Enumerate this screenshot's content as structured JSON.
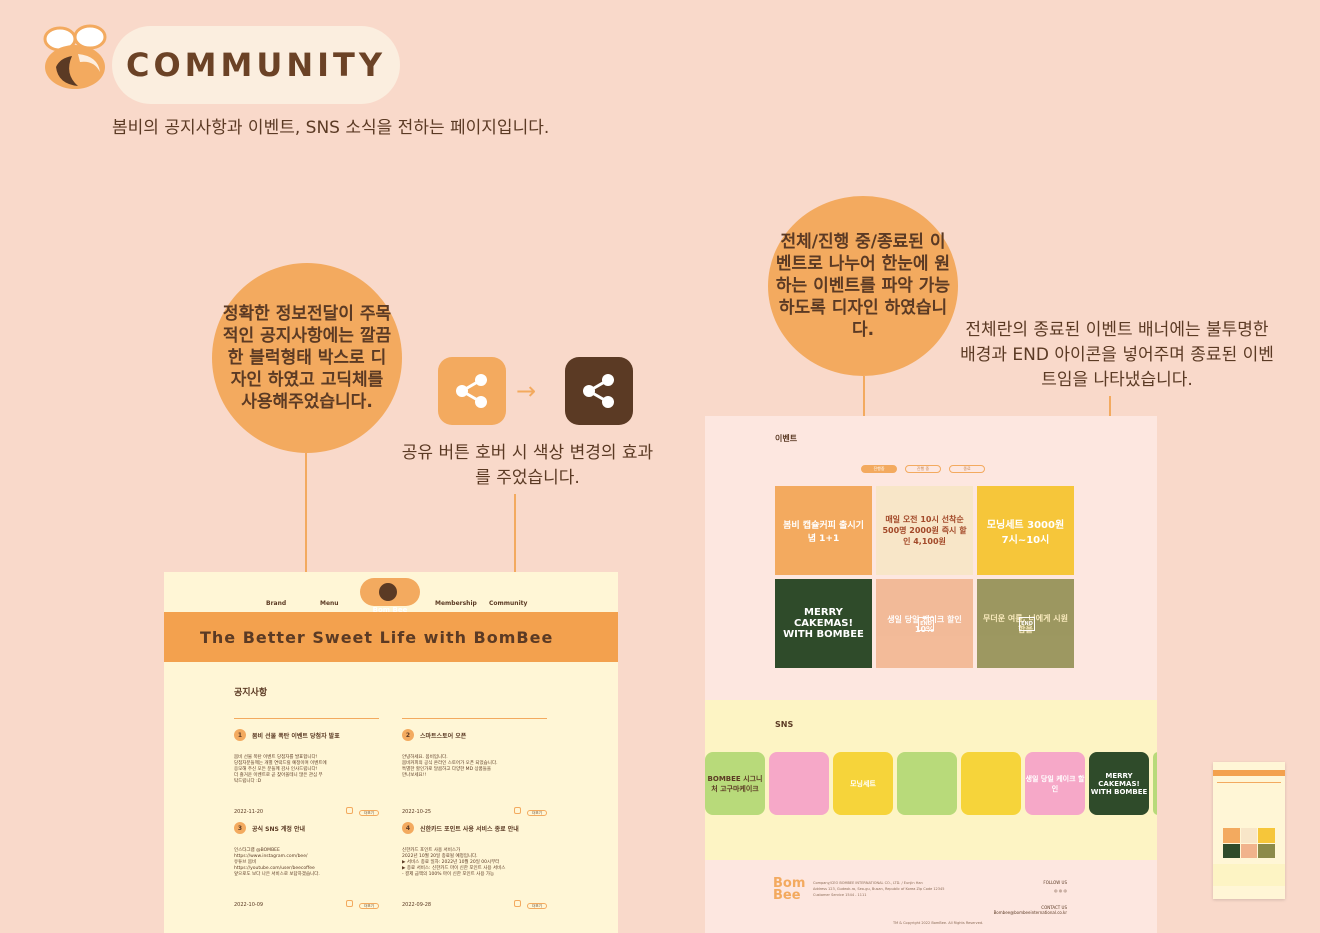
{
  "header": {
    "title": "COMMUNITY",
    "subtitle": "봄비의 공지사항과 이벤트, SNS 소식을 전하는 페이지입니다."
  },
  "callouts": {
    "notice": "정확한 정보전달이 주목적인 공지사항에는 깔끔한 블럭형태 박스로 디자인 하였고 고딕체를 사용해주었습니다.",
    "filter": "전체/진행 중/종료된 이벤트로 나누어 한눈에 원하는 이벤트를 파악 가능하도록 디자인 하였습니다.",
    "share": "공유 버튼 호버 시 색상 변경의 효과를 주었습니다.",
    "ended": "전체란의 종료된 이벤트 배너에는 불투명한 배경과 END 아이콘을 넣어주며 종료된 이벤트임을 나타냈습니다."
  },
  "left_mock": {
    "nav": [
      "Brand",
      "Menu",
      "Membership",
      "Community"
    ],
    "badge": "Bom Bee",
    "banner": "The Better Sweet Life with BomBee",
    "banner_next": "T",
    "section": "공지사항",
    "notices": [
      {
        "num": "1",
        "title": "봄비 선물 폭탄 이벤트 당첨자 발표",
        "body": "봄비 선물 폭탄 이벤트 당첨자를 발표합니다!\n당첨자분들께는 개별 연락드릴 예정이며 이벤트에\n응모해 주신 모든 분들께 감사 인사드립니다!\n더 즐거운 이벤트로 곧 찾아올테니 많은 관심 부\n탁드립니다 :D",
        "date": "2022-11-20",
        "btn": "더보기"
      },
      {
        "num": "2",
        "title": "스마트스토어 오픈",
        "body": "안녕하세요. 봄비입니다.\n봄비커피의 공식 온라인 스토어가 오픈 되었습니다.\n특별한 할인가로 달콤하고 다양한 MD 상품들을\n만나보세요!!",
        "date": "2022-10-25",
        "btn": "더보기"
      },
      {
        "num": "3",
        "title": "공식 SNS 계정 안내",
        "body": "인스타그램 @BOMBEE\nhttps://www.instagram.com/bee/\n유튜브 봄비\nhttps://youtube.com/user/beecoffee\n앞으로도 보다 나은 서비스로 보답하겠습니다.",
        "date": "2022-10-09",
        "btn": "더보기"
      },
      {
        "num": "4",
        "title": "신한카드 포인트 사용 서비스 종료 안내",
        "body": "신한카드 포인트 사용 서비스가\n2022년 10월 20일 종료될 예정입니다.\n▶ 서비스 종료 일자: 2022년 10월 20일 00시부터\n▶ 종료 서비스: 신한카드 마이 신한 포인트 사용 서비스\n- 결제 금액의 100% 마이 신한 포인트 사용 가능",
        "date": "2022-09-28",
        "btn": "더보기"
      }
    ]
  },
  "right_mock": {
    "title": "이벤트",
    "filters": [
      "진행중",
      "진행 중",
      "종료"
    ],
    "tiles": [
      {
        "text": "봄비 캡슐커피 출시기념 1+1",
        "bg": "#f3aa5f",
        "fg": "#ffffff"
      },
      {
        "text": "매일 오전 10시 선착순 500명 2000원 즉시 할인 4,100원",
        "bg": "#f8e6c8",
        "fg": "#a34a2a"
      },
      {
        "text": "모닝세트 3000원 7시~10시",
        "bg": "#f6c63a",
        "fg": "#ffffff"
      },
      {
        "text": "MERRY CAKEMAS! WITH BOMBEE",
        "bg": "#2f4b2a",
        "fg": "#ffffff"
      },
      {
        "text": "생일 당일 케이크 할인 10%",
        "bg": "#f1b38c",
        "fg": "#ffffff"
      },
      {
        "text": "무더운 여름, 너에게 시원함을",
        "bg": "#8c8a4a",
        "fg": "#f7e9b5"
      }
    ],
    "end_label": "END",
    "sns_title": "SNS",
    "sns": [
      {
        "text": "BOMBEE 시그니처 고구마케이크",
        "bg": "#b8da7a"
      },
      {
        "text": "",
        "bg": "#f6a8c8"
      },
      {
        "text": "모닝세트",
        "bg": "#f6d43a"
      },
      {
        "text": "",
        "bg": "#b8da7a"
      },
      {
        "text": "",
        "bg": "#f6d43a"
      },
      {
        "text": "생일 당일 케이크 할인",
        "bg": "#f6a8c8"
      },
      {
        "text": "MERRY CAKEMAS! WITH BOMBEE",
        "bg": "#2f4b2a"
      }
    ],
    "footer": {
      "logo": "Bom Bee",
      "info": "Company/CEO BOMBEE INTERNATIONAL CO., LTD. / Eunjin Han\nAddress 123, Gudeok-ro, Seo-gu, Busan, Republic of Korea Zip Code 12345\nCustomer Service 1544 - 1111",
      "follow": "FOLLOW US",
      "contact": "CONTACT US",
      "email": "Bombee@bombeeinternational.co.kr",
      "copy": "TM & Copyright 2022 BomBee. All Rights Reserved."
    }
  }
}
